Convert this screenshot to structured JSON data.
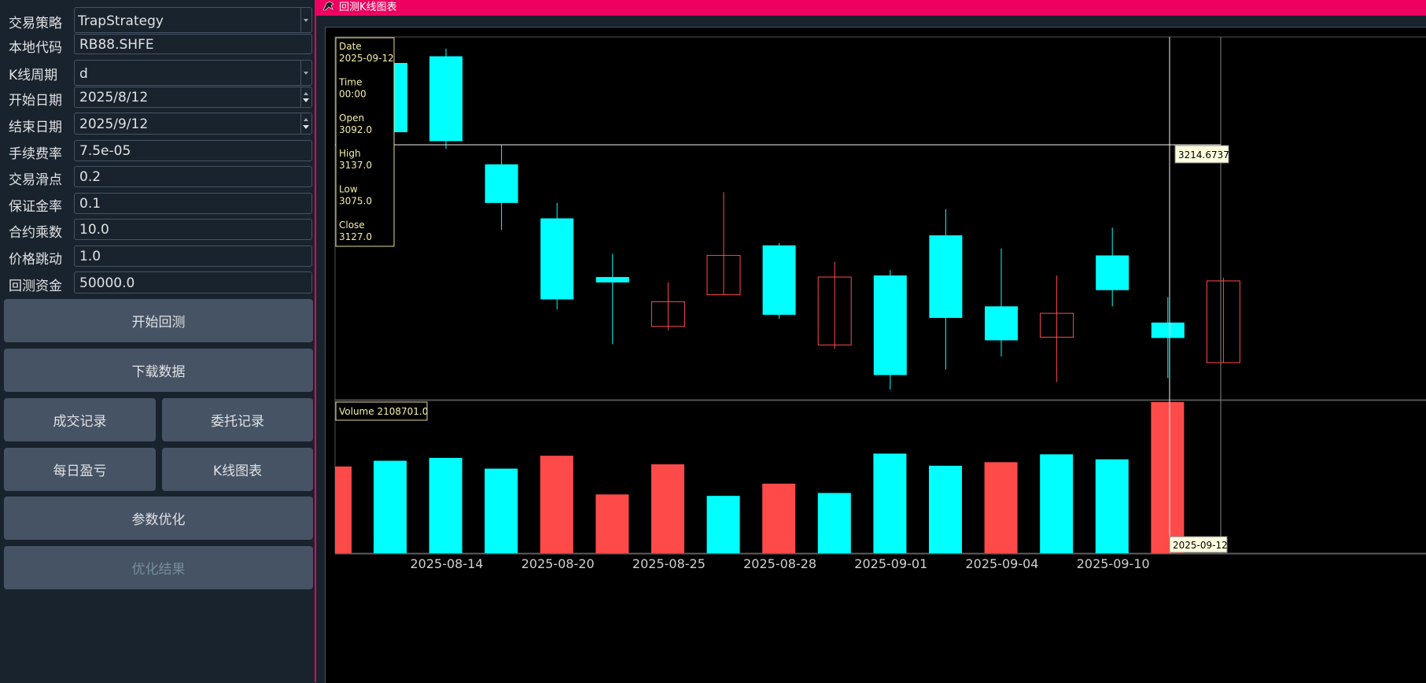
{
  "form": {
    "strategy": {
      "label": "交易策略",
      "value": "TrapStrategy"
    },
    "code": {
      "label": "本地代码",
      "value": "RB88.SHFE"
    },
    "interval": {
      "label": "K线周期",
      "value": "d"
    },
    "start": {
      "label": "开始日期",
      "value": "2025/8/12"
    },
    "end": {
      "label": "结束日期",
      "value": "2025/9/12"
    },
    "rate": {
      "label": "手续费率",
      "value": "7.5e-05"
    },
    "slippage": {
      "label": "交易滑点",
      "value": "0.2"
    },
    "margin": {
      "label": "保证金率",
      "value": "0.1"
    },
    "size": {
      "label": "合约乘数",
      "value": "10.0"
    },
    "pricetick": {
      "label": "价格跳动",
      "value": "1.0"
    },
    "capital": {
      "label": "回测资金",
      "value": "50000.0"
    }
  },
  "buttons": {
    "start_backtest": "开始回测",
    "download": "下载数据",
    "trades": "成交记录",
    "orders": "委托记录",
    "daily": "每日盈亏",
    "kline": "K线图表",
    "optimize": "参数优化",
    "opt_result": "优化结果"
  },
  "window": {
    "title": "回测K线图表"
  },
  "infobox": {
    "date_label": "Date",
    "date": "2025-09-12",
    "time_label": "Time",
    "time": "00:00",
    "open_label": "Open",
    "open": "3092.0",
    "high_label": "High",
    "high": "3137.0",
    "low_label": "Low",
    "low": "3075.0",
    "close_label": "Close",
    "close": "3127.0"
  },
  "volume_box": "Volume 2108701.0",
  "crosshair": {
    "price": "3214.6737",
    "date": "2025-09-12"
  },
  "colors": {
    "up": "#ff4a4a",
    "down": "#00ffff",
    "bg": "#000000",
    "accent": "#ed0060",
    "tooltip": "#ffffe0"
  },
  "chart_data": {
    "type": "candlestick",
    "x_tick_labels": [
      "2025-08-14",
      "2025-08-20",
      "2025-08-25",
      "2025-08-28",
      "2025-09-01",
      "2025-09-04",
      "2025-09-10"
    ],
    "candles": [
      {
        "type": "down",
        "open": 3290,
        "close": 3180,
        "high": 3300,
        "low": 3170
      },
      {
        "type": "down",
        "open": 3150,
        "close": 3100,
        "high": 3175,
        "low": 3065
      },
      {
        "type": "down",
        "open": 3080,
        "close": 2975,
        "high": 3100,
        "low": 2962
      },
      {
        "type": "down",
        "open": 3004,
        "close": 2997,
        "high": 3034,
        "low": 2917
      },
      {
        "type": "up",
        "open": 2940,
        "close": 2972,
        "high": 2997,
        "low": 2935
      },
      {
        "type": "up",
        "open": 2981,
        "close": 3032,
        "high": 3114,
        "low": 2981
      },
      {
        "type": "down",
        "open": 3045,
        "close": 2955,
        "high": 3048,
        "low": 2950
      },
      {
        "type": "up",
        "open": 2916,
        "close": 3004,
        "high": 3024,
        "low": 2911
      },
      {
        "type": "down",
        "open": 3006,
        "close": 2877,
        "high": 3013,
        "low": 2858
      },
      {
        "type": "down",
        "open": 3058,
        "close": 2951,
        "high": 3092,
        "low": 2884
      },
      {
        "type": "down",
        "open": 2966,
        "close": 2922,
        "high": 3041,
        "low": 2901
      },
      {
        "type": "up",
        "open": 2926,
        "close": 2957,
        "high": 3006,
        "low": 2868
      },
      {
        "type": "down",
        "open": 3032,
        "close": 2987,
        "high": 3068,
        "low": 2966
      },
      {
        "type": "down",
        "open": 2945,
        "close": 2925,
        "high": 2978,
        "low": 2873
      },
      {
        "type": "up",
        "open": 2893,
        "close": 2999,
        "high": 3003,
        "low": 2893
      }
    ],
    "volumes": [
      1210000,
      1290000,
      1330000,
      1180000,
      1360000,
      820000,
      1240000,
      800000,
      970000,
      840000,
      1390000,
      1220000,
      1270000,
      1380000,
      1310000,
      2108701
    ]
  }
}
